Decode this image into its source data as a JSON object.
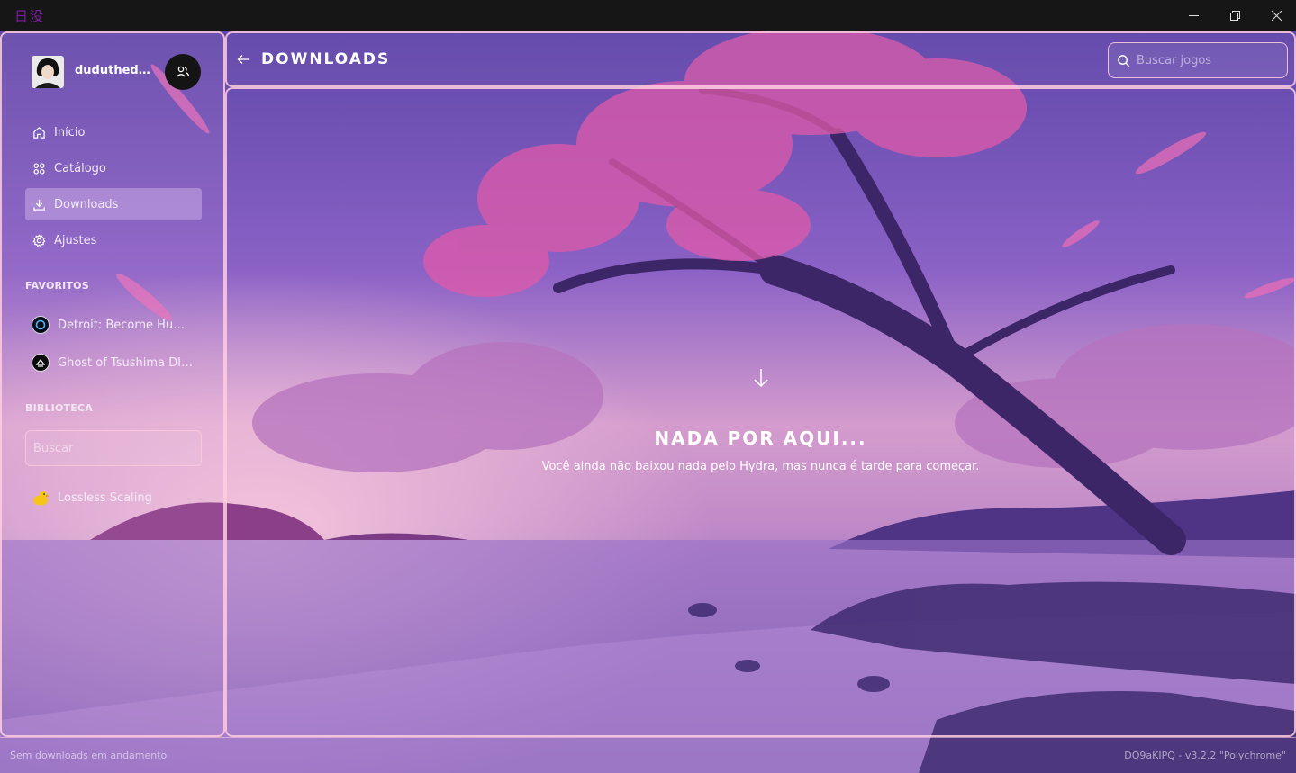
{
  "window": {
    "app_title": "日没",
    "controls": [
      "minimize-icon",
      "restore-icon",
      "close-icon"
    ]
  },
  "sidebar": {
    "profile": {
      "name": "duduthede..."
    },
    "nav": [
      {
        "label": "Início",
        "icon": "home-icon",
        "active": false
      },
      {
        "label": "Catálogo",
        "icon": "grid-icon",
        "active": false
      },
      {
        "label": "Downloads",
        "icon": "download-icon",
        "active": true
      },
      {
        "label": "Ajustes",
        "icon": "gear-icon",
        "active": false
      }
    ],
    "favorites": {
      "label": "FAVORITOS",
      "items": [
        {
          "label": "Detroit: Become Human",
          "icon": "detroit-game-icon"
        },
        {
          "label": "Ghost of Tsushima DIR...",
          "icon": "ghost-of-tsushima-game-icon"
        }
      ]
    },
    "library": {
      "label": "BIBLIOTECA",
      "search_placeholder": "Buscar",
      "items": [
        {
          "label": "Lossless Scaling",
          "icon": "duck-icon"
        }
      ]
    }
  },
  "header": {
    "title": "DOWNLOADS",
    "search_placeholder": "Buscar jogos"
  },
  "main": {
    "empty_title": "NADA POR AQUI...",
    "empty_subtitle": "Você ainda não baixou nada pelo Hydra, mas nunca é tarde para começar."
  },
  "footer": {
    "status": "Sem downloads em andamento",
    "version": "DQ9aKIPQ - v3.2.2 \"Polychrome\""
  },
  "colors": {
    "accent_border": "#ffcde1",
    "titlebar_bg": "#161616",
    "app_title": "#7b1fa2"
  }
}
